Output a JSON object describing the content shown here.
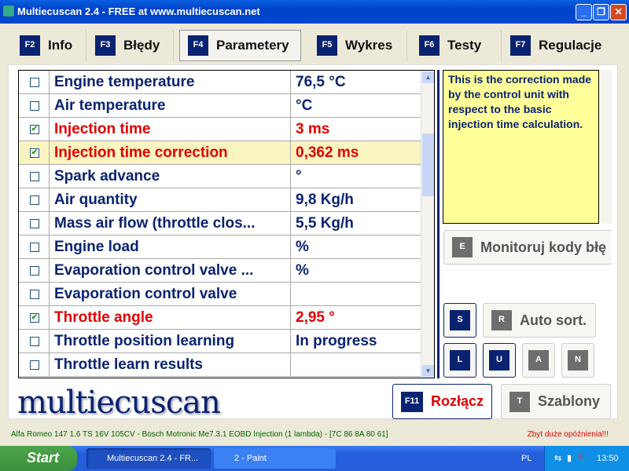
{
  "window": {
    "title": "Multiecuscan 2.4 - FREE at www.multiecuscan.net"
  },
  "tabs": [
    {
      "key": "F2",
      "label": "Info"
    },
    {
      "key": "F3",
      "label": "Błędy"
    },
    {
      "key": "F4",
      "label": "Parametery"
    },
    {
      "key": "F5",
      "label": "Wykres"
    },
    {
      "key": "F6",
      "label": "Testy"
    },
    {
      "key": "F7",
      "label": "Regulacje"
    }
  ],
  "parameters": [
    {
      "checked": false,
      "name": "Engine temperature",
      "value": "76,5 °C"
    },
    {
      "checked": false,
      "name": "Air temperature",
      "value": " °C"
    },
    {
      "checked": true,
      "name": "Injection time",
      "value": "3 ms"
    },
    {
      "checked": true,
      "name": "Injection time correction",
      "value": "0,362 ms"
    },
    {
      "checked": false,
      "name": "Spark advance",
      "value": " °"
    },
    {
      "checked": false,
      "name": "Air quantity",
      "value": "9,8 Kg/h"
    },
    {
      "checked": false,
      "name": "Mass air flow (throttle clos...",
      "value": "5,5 Kg/h"
    },
    {
      "checked": false,
      "name": "Engine load",
      "value": " %"
    },
    {
      "checked": false,
      "name": "Evaporation control valve ...",
      "value": " %"
    },
    {
      "checked": false,
      "name": "Evaporation control valve",
      "value": ""
    },
    {
      "checked": true,
      "name": "Throttle angle",
      "value": "2,95 °"
    },
    {
      "checked": false,
      "name": "Throttle position learning",
      "value": "In progress"
    },
    {
      "checked": false,
      "name": "Throttle learn results",
      "value": ""
    }
  ],
  "description": "This is the correction made by the control unit with respect to the basic injection time calculation.",
  "buttons": {
    "monitor_key": "E",
    "monitor": "Monitoruj kody błę",
    "s": "S",
    "autosort_key": "R",
    "autosort": "Auto sort.",
    "l": "L",
    "u": "U",
    "a": "A",
    "n": "N",
    "disconnect_key": "F11",
    "disconnect": "Rozłącz",
    "templates_key": "T",
    "templates": "Szablony"
  },
  "logo": "multiecuscan",
  "status": {
    "vehicle": "Alfa Romeo 147 1.6 TS 16V 105CV - Bosch Motronic Me7.3.1 EOBD Injection (1 lambda) - [7C 86 8A 80 61]",
    "warning": "Zbyt duże opóźnienia!!!"
  },
  "taskbar": {
    "start": "Start",
    "items": [
      "Multiecuscan 2.4 - FR...",
      "2 - Paint"
    ],
    "lang": "PL",
    "clock": "13:50"
  }
}
